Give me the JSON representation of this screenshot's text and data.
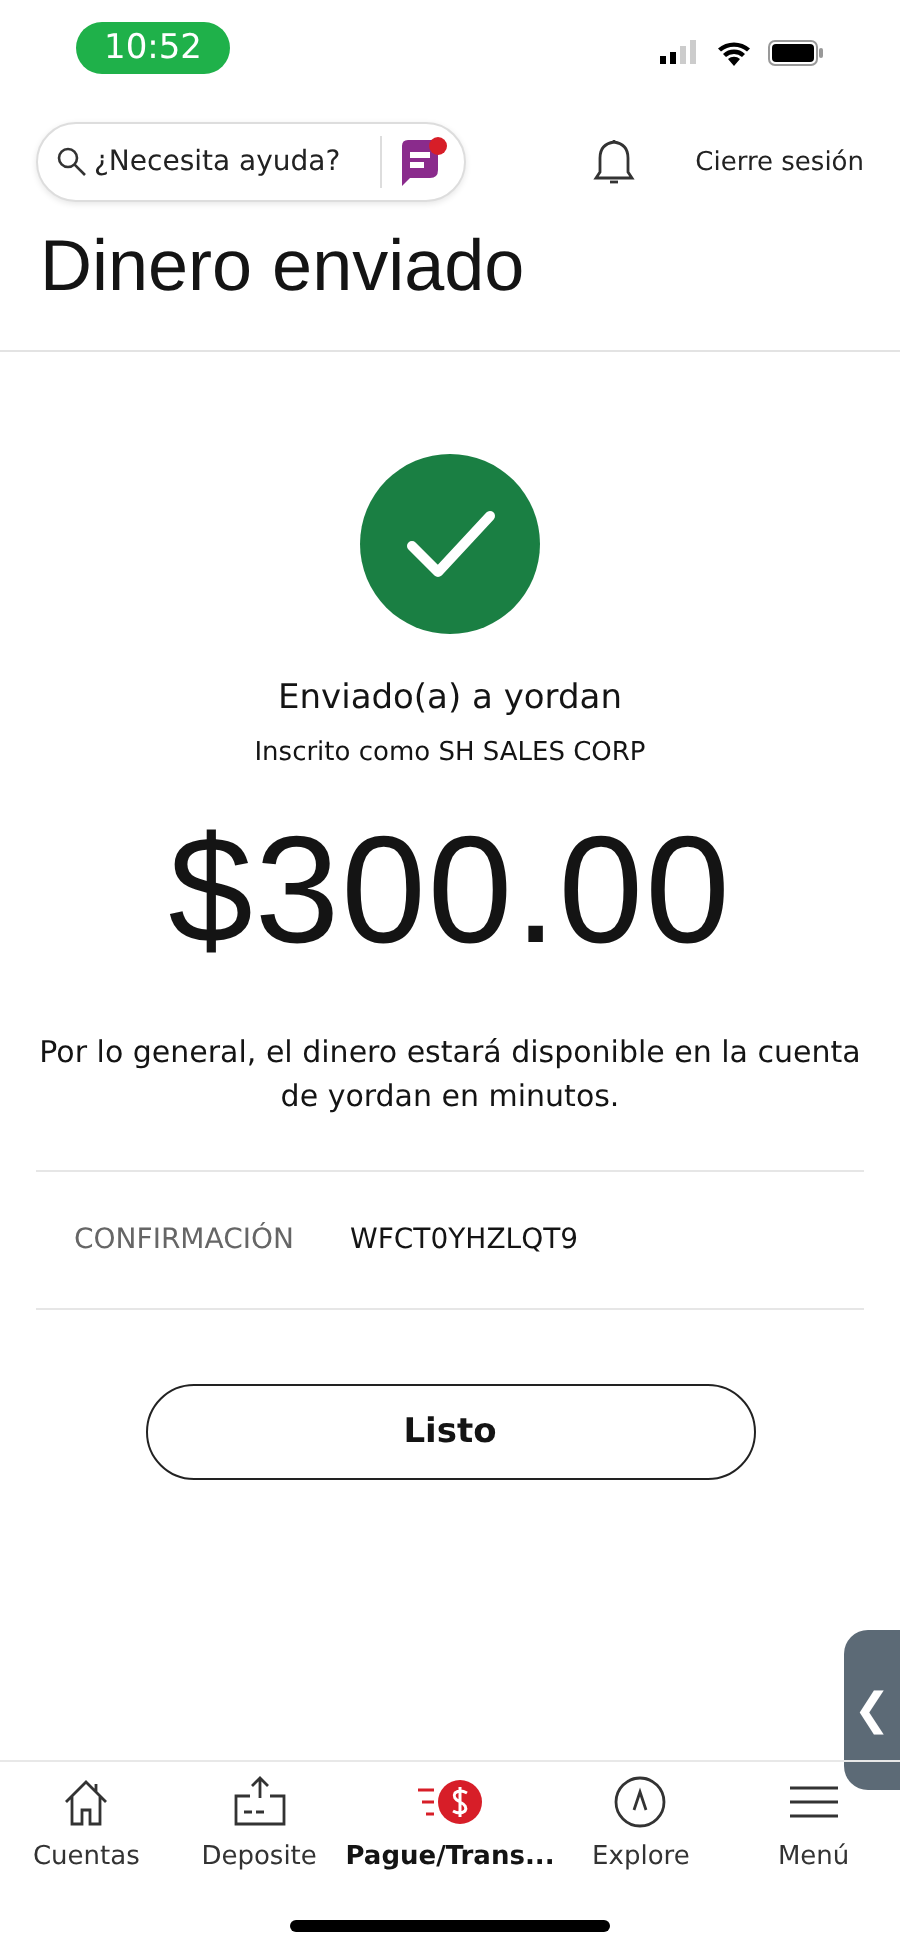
{
  "status_bar": {
    "time": "10:52"
  },
  "header": {
    "search": {
      "placeholder": "¿Necesita ayuda?"
    },
    "logout": "Cierre sesión"
  },
  "title": "Dinero enviado",
  "result": {
    "recipient": "Enviado(a) a yordan",
    "registered_as": "Inscrito como SH SALES CORP",
    "amount": "$300.00",
    "note": "Por lo general, el dinero estará disponible en la cuenta de yordan en minutos."
  },
  "confirmation": {
    "label": "CONFIRMACIÓN",
    "value": "WFCT0YHZLQT9"
  },
  "done_button": "Listo",
  "side_tab": {
    "glyph": "❮"
  },
  "nav": [
    {
      "label": "Cuentas",
      "kind": "home",
      "selected": false
    },
    {
      "label": "Deposite",
      "kind": "deposit",
      "selected": false
    },
    {
      "label": "Pague/Trans...",
      "kind": "pay",
      "selected": true
    },
    {
      "label": "Explore",
      "kind": "explore",
      "selected": false
    },
    {
      "label": "Menú",
      "kind": "menu",
      "selected": false
    }
  ]
}
